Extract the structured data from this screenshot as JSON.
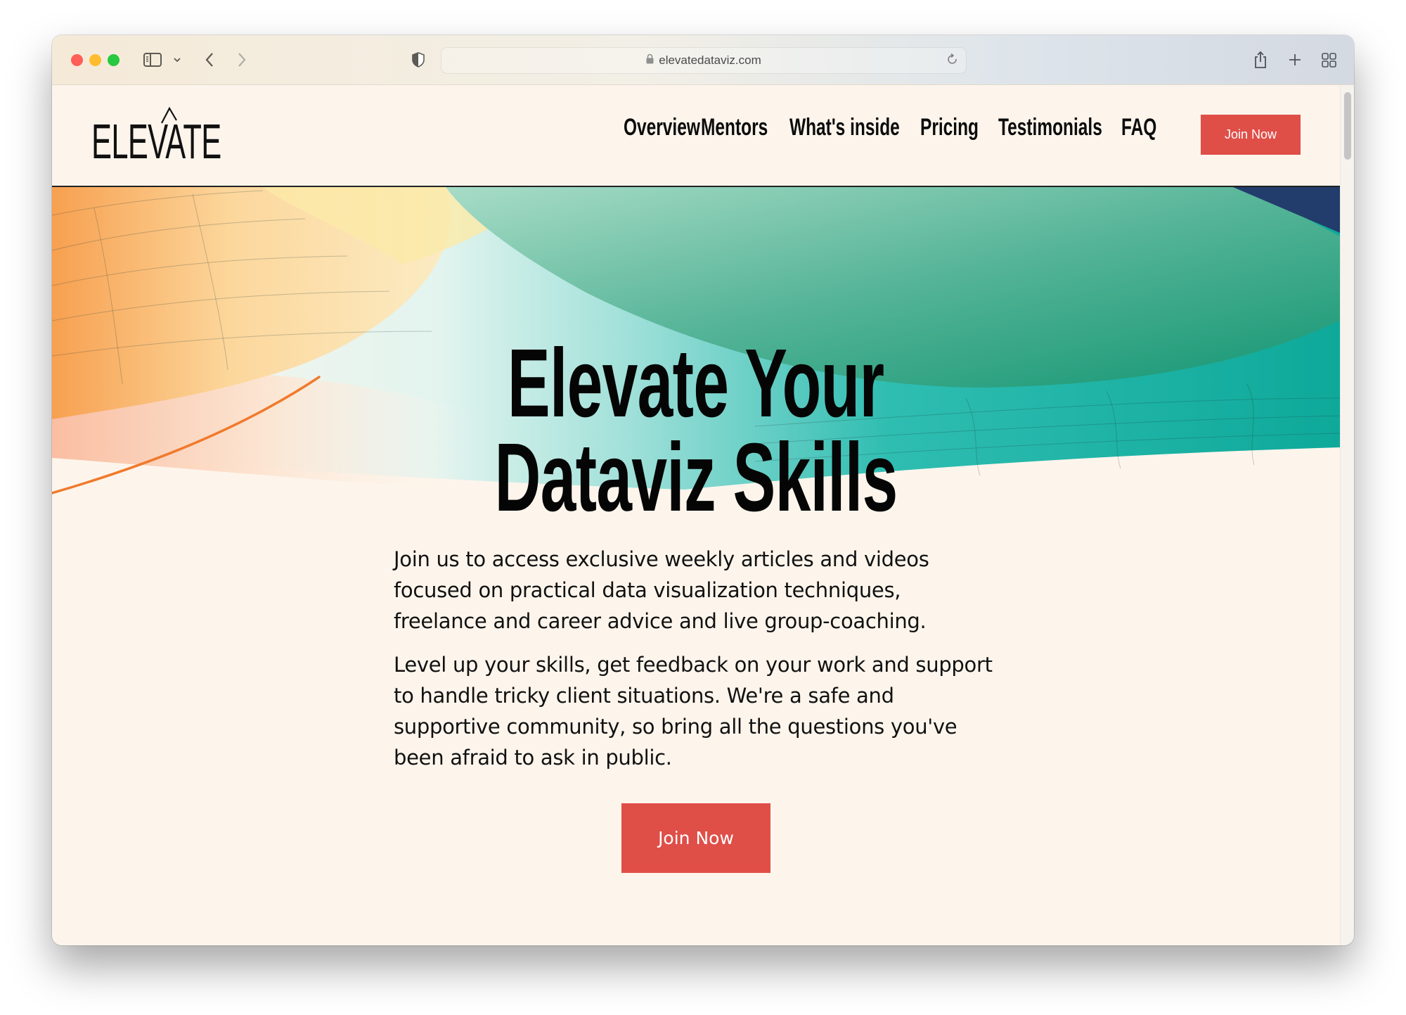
{
  "browser": {
    "url": "elevatedataviz.com",
    "icons": {
      "sidebar": "sidebar-icon",
      "tab_overview_chevron": "chevron-down-icon",
      "back": "chevron-left-icon",
      "forward": "chevron-right-icon",
      "privacy": "shield-icon",
      "lock": "lock-icon",
      "reload": "reload-icon",
      "share": "share-icon",
      "new_tab": "plus-icon",
      "tab_overview": "grid-icon"
    }
  },
  "site": {
    "logo_text": "ELEVATE",
    "nav": [
      {
        "label": "Overview"
      },
      {
        "label": "Mentors"
      },
      {
        "label": "What's inside"
      },
      {
        "label": "Pricing"
      },
      {
        "label": "Testimonials"
      },
      {
        "label": "FAQ"
      }
    ],
    "header_cta": "Join Now",
    "accent_color": "#e04e48",
    "background_color": "#fdf5ec"
  },
  "hero": {
    "title_line1": "Elevate Your",
    "title_line2": "Dataviz Skills",
    "paragraphs": [
      "Join us to access exclusive weekly articles and videos focused on practical data visualization techniques, freelance and career advice and live group-coaching.",
      "Level up your skills, get feedback on your work and support to handle tricky client situations. We're a safe and supportive community, so bring all the questions you've been afraid to ask in public."
    ],
    "cta": "Join Now"
  }
}
